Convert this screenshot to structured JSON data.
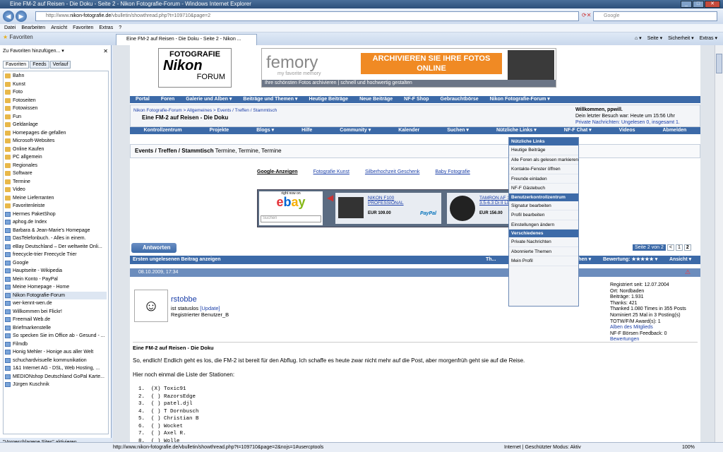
{
  "window": {
    "title": "Eine FM-2 auf Reisen - Die Doku - Seite 2 - Nikon Fotografie-Forum - Windows Internet Explorer"
  },
  "address": {
    "url_prefix": "http://www.",
    "url_domain": "nikon-fotografie.de",
    "url_rest": "/vbulletin/showthread.php?t=109710&page=2",
    "search_placeholder": "Google"
  },
  "menu": [
    "Datei",
    "Bearbeiten",
    "Ansicht",
    "Favoriten",
    "Extras",
    "?"
  ],
  "tabs": {
    "favorites_label": "Favoriten",
    "active_tab": "Eine FM-2 auf Reisen - Die Doku - Seite 2 - Nikon ...",
    "tools": [
      "Seite ▾",
      "Sicherheit ▾",
      "Extras ▾"
    ]
  },
  "sidebar": {
    "add_label": "Zu Favoriten hinzufügen... ▾",
    "tabs": [
      "Favoriten",
      "Feeds",
      "Verlauf"
    ],
    "items": [
      {
        "t": "Bahn",
        "k": "folder"
      },
      {
        "t": "Kunst",
        "k": "folder"
      },
      {
        "t": "Foto",
        "k": "folder"
      },
      {
        "t": "Fotoseiten",
        "k": "folder"
      },
      {
        "t": "Fotowissen",
        "k": "folder"
      },
      {
        "t": "Fun",
        "k": "folder"
      },
      {
        "t": "Geldanlage",
        "k": "folder"
      },
      {
        "t": "Homepages die gefallen",
        "k": "folder"
      },
      {
        "t": "Microsoft-Websites",
        "k": "folder"
      },
      {
        "t": "Online Kaufen",
        "k": "folder"
      },
      {
        "t": "PC allgemein",
        "k": "folder"
      },
      {
        "t": "Regionales",
        "k": "folder"
      },
      {
        "t": "Software",
        "k": "folder"
      },
      {
        "t": "Termine",
        "k": "folder"
      },
      {
        "t": "Video",
        "k": "folder"
      },
      {
        "t": "Meine Lieferranten",
        "k": "folder"
      },
      {
        "t": "Favoritenleiste",
        "k": "folder"
      },
      {
        "t": "Hermes PaketShop",
        "k": "page"
      },
      {
        "t": "aphog.de Index",
        "k": "page"
      },
      {
        "t": "Barbara & Jean-Marie's Homepage",
        "k": "page"
      },
      {
        "t": "DasTelefonbuch. - Alles in einem.",
        "k": "page"
      },
      {
        "t": "eBay Deutschland – Der weltweite Onli...",
        "k": "page"
      },
      {
        "t": "freecycle-trier Freecycle Trier",
        "k": "page"
      },
      {
        "t": "Google",
        "k": "page"
      },
      {
        "t": "Hauptseite - Wikipedia",
        "k": "page"
      },
      {
        "t": "Mein Konto - PayPal",
        "k": "page"
      },
      {
        "t": "Meine Homepage - Home",
        "k": "page"
      },
      {
        "t": "Nikon Fotografie-Forum",
        "k": "page"
      },
      {
        "t": "wer-kennt-wen.de",
        "k": "page"
      },
      {
        "t": "Willkommen bei Flickr!",
        "k": "page"
      },
      {
        "t": "Freemail Web.de",
        "k": "page"
      },
      {
        "t": "Briefmarkenstelle",
        "k": "page"
      },
      {
        "t": "So specken Sie im Office ab - Gesund - ...",
        "k": "page"
      },
      {
        "t": "Filmdb",
        "k": "page"
      },
      {
        "t": "Honig Mehler - Honige aus aller Welt",
        "k": "page"
      },
      {
        "t": "schuchardvisuelle kommunikation",
        "k": "page"
      },
      {
        "t": "1&1 Internet AG - DSL, Web Hosting, ...",
        "k": "page"
      },
      {
        "t": "MEDIONshop Deutschland GoPal Karte...",
        "k": "page"
      },
      {
        "t": "Jürgen Kuschnik",
        "k": "page"
      }
    ],
    "footer": "\"Vorgeschlagene Sites\" aktivieren..."
  },
  "forum": {
    "logo_top": "FOTOGRAFIE",
    "logo_mid": "Nikon",
    "logo_bot": "FORUM",
    "banner_brand": "femory",
    "banner_tagline": "my favorite memory",
    "banner_cta": "ARCHIVIEREN SIE IHRE FOTOS ONLINE",
    "banner_sub": "Ihre schönsten Fotos archivieren | schnell und hochwertig gestalten",
    "nav1": [
      "Portal",
      "Foren",
      "Galerie und Alben ▾",
      "Beiträge und Themen ▾",
      "Heutige Beiträge",
      "Neue Beiträge",
      "NF-F Shop",
      "Gebrauchtbörse",
      "Nikon Fotografie-Forum ▾"
    ],
    "crumb": "Nikon Fotografie-Forum > Allgemeines > Events / Treffen / Stammtisch",
    "thread_title": "Eine FM-2 auf Reisen - Die Doku",
    "welcome": "Willkommen, ppwill.",
    "last_visit": "Dein letzter Besuch war: Heute um 15:56 Uhr",
    "pm": "Private Nachrichten: Ungelesen 0, insgesamt 1.",
    "nav2": [
      "Kontrollzentrum",
      "Projekte",
      "Blogs ▾",
      "Hilfe",
      "Community ▾",
      "Kalender",
      "Suchen ▾",
      "Nützliche Links ▾",
      "NF-F Chat ▾",
      "Videos",
      "Abmelden"
    ],
    "forum_name": "Events / Treffen / Stammtisch",
    "forum_desc": "Termine, Termine, Termine",
    "ads": [
      "Google-Anzeigen",
      "Fotografie Kunst",
      "Silberhochzeit Geschenk",
      "Baby Fotografie"
    ],
    "ebay": {
      "label": "right now on",
      "search": "Suchen",
      "p1_title": "NIKON F100 PROFESSIONAL",
      "p1_price": "EUR 109.00",
      "p2_title": "TAMRON AF 18-250mm 3.5-6.3 Di II LD ASL...",
      "p2_price": "EUR 156.00",
      "paypal": "PayPal"
    },
    "reply_btn": "Antworten",
    "pages": "Seite 2 von 2",
    "page_nums": [
      "<",
      "1",
      "2"
    ],
    "post_bar": "Ersten ungelesenen Beitrag anzeigen",
    "post_bar_right": [
      "Th...",
      "urchsuchen ▾",
      "Bewertung: ★★★★★ ▾",
      "Ansicht ▾"
    ],
    "post_date": "08.10.2009, 17:34",
    "author": "rstobbe",
    "status": "ist statuslos",
    "update": "[Update]",
    "role": "Registrierter Benutzer_B",
    "stats": [
      "Registriert seit: 12.07.2004",
      "Ort: Nordbaden",
      "Beiträge: 1.931",
      "Thanks: 421",
      "Thanked 1.080 Times in 355 Posts",
      "Nominiert 25 Mal in 3 Posting(s)",
      "TOTW/F/M Award(s): 1",
      "Alben des Mitglieds",
      "NF-F Börsen Feedback: 0",
      "Bewertungen"
    ],
    "post_title": "Eine FM-2 auf Reisen - Die Doku",
    "post_text": "So, endlich! Endlich geht es los, die FM-2 ist bereit für den Abflug. Ich schaffe es heute zwar nicht mehr auf die Post, aber morgenfrüh geht sie auf die Reise.",
    "list_intro": "Hier noch einmal die Liste der Stationen:",
    "stations": [
      "1.  (X) Toxic91",
      "2.  ( ) RazorsEdge",
      "3.  ( ) patel.djl",
      "4.  ( ) T Dornbusch",
      "5.  ( ) Christian B",
      "6.  ( ) Wocket",
      "7.  ( ) Axel R.",
      "8.  ( ) Wolle"
    ]
  },
  "dropdown": {
    "h1": "Nützliche Links",
    "items1": [
      "Heutige Beiträge",
      "Alle Foren als gelesen markieren",
      "Kontakte-Fenster öffnen",
      "Freunde einladen",
      "NF-F Gästebuch"
    ],
    "h2": "Benutzerkontrollzentrum",
    "items2": [
      "Signatur bearbeiten",
      "Profil bearbeiten",
      "Einstellungen ändern"
    ],
    "h3": "Verschiedenes",
    "items3": [
      "Private Nachrichten",
      "Abonnierte Themen",
      "Mein Profil"
    ]
  },
  "status": {
    "url": "http://www.nikon-fotografie.de/vbulletin/showthread.php?t=109710&page=2&nojs=1#usercptools",
    "zone": "Internet | Geschützter Modus: Aktiv",
    "zoom": "100%"
  },
  "colors": {
    "nav": "#3c6aa8",
    "accent_orange": "#f08a24"
  }
}
